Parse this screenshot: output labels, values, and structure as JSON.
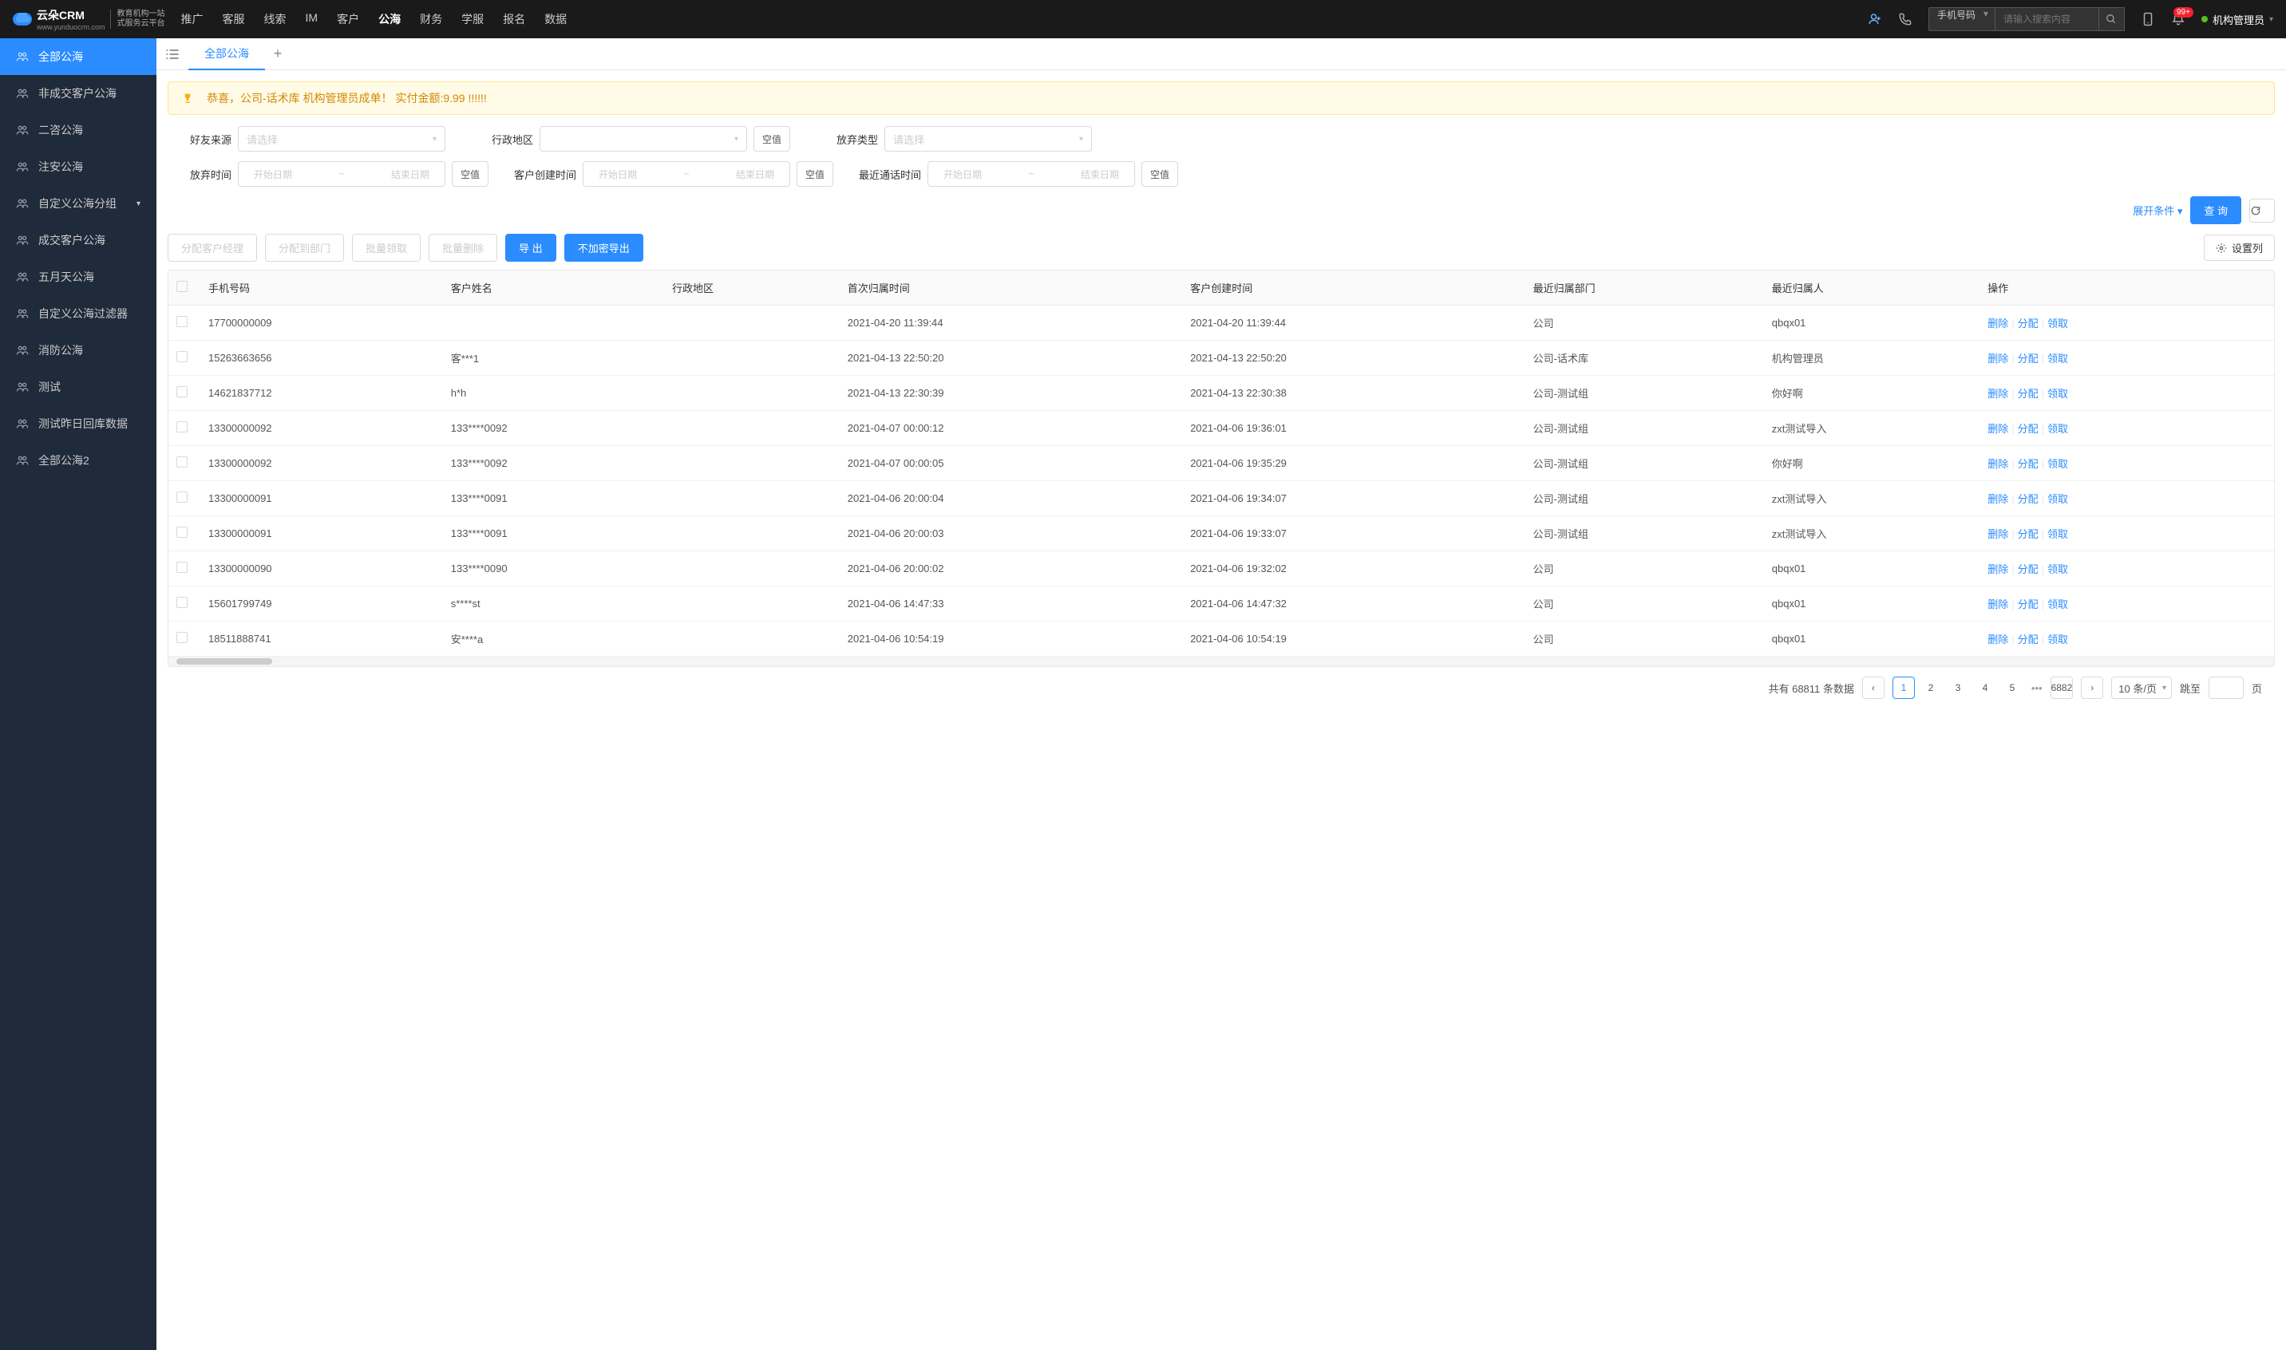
{
  "header": {
    "logo_title": "云朵CRM",
    "logo_sub1": "教育机构一站",
    "logo_sub2": "式服务云平台",
    "logo_url": "www.yunduocrm.com",
    "nav": [
      "推广",
      "客服",
      "线索",
      "IM",
      "客户",
      "公海",
      "财务",
      "学服",
      "报名",
      "数据"
    ],
    "nav_active": 5,
    "search_type": "手机号码",
    "search_placeholder": "请输入搜索内容",
    "badge": "99+",
    "user": "机构管理员"
  },
  "sidebar": [
    {
      "label": "全部公海",
      "active": true
    },
    {
      "label": "非成交客户公海"
    },
    {
      "label": "二咨公海"
    },
    {
      "label": "注安公海"
    },
    {
      "label": "自定义公海分组",
      "expandable": true
    },
    {
      "label": "成交客户公海"
    },
    {
      "label": "五月天公海"
    },
    {
      "label": "自定义公海过滤器"
    },
    {
      "label": "消防公海"
    },
    {
      "label": "测试"
    },
    {
      "label": "测试昨日回库数据"
    },
    {
      "label": "全部公海2"
    }
  ],
  "tab": {
    "label": "全部公海"
  },
  "banner": "恭喜，公司-话术库  机构管理员成单！  实付金额:9.99 !!!!!!",
  "filters": {
    "source_label": "好友来源",
    "region_label": "行政地区",
    "abandon_type_label": "放弃类型",
    "abandon_time_label": "放弃时间",
    "create_time_label": "客户创建时间",
    "call_time_label": "最近通话时间",
    "select_placeholder": "请选择",
    "start_placeholder": "开始日期",
    "end_placeholder": "结束日期",
    "null_btn": "空值",
    "expand": "展开条件",
    "query": "查 询"
  },
  "toolbar": {
    "assign_manager": "分配客户经理",
    "assign_dept": "分配到部门",
    "batch_claim": "批量领取",
    "batch_delete": "批量删除",
    "export": "导 出",
    "export_plain": "不加密导出",
    "columns": "设置列"
  },
  "table": {
    "columns": [
      "手机号码",
      "客户姓名",
      "行政地区",
      "首次归属时间",
      "客户创建时间",
      "最近归属部门",
      "最近归属人",
      "操作"
    ],
    "actions": {
      "delete": "删除",
      "assign": "分配",
      "claim": "领取"
    },
    "rows": [
      {
        "phone": "17700000009",
        "name": "",
        "region": "",
        "first_time": "2021-04-20 11:39:44",
        "create_time": "2021-04-20 11:39:44",
        "dept": "公司",
        "owner": "qbqx01"
      },
      {
        "phone": "15263663656",
        "name": "客***1",
        "region": "",
        "first_time": "2021-04-13 22:50:20",
        "create_time": "2021-04-13 22:50:20",
        "dept": "公司-话术库",
        "owner": "机构管理员"
      },
      {
        "phone": "14621837712",
        "name": "h*h",
        "region": "",
        "first_time": "2021-04-13 22:30:39",
        "create_time": "2021-04-13 22:30:38",
        "dept": "公司-测试组",
        "owner": "你好啊"
      },
      {
        "phone": "13300000092",
        "name": "133****0092",
        "region": "",
        "first_time": "2021-04-07 00:00:12",
        "create_time": "2021-04-06 19:36:01",
        "dept": "公司-测试组",
        "owner": "zxt测试导入"
      },
      {
        "phone": "13300000092",
        "name": "133****0092",
        "region": "",
        "first_time": "2021-04-07 00:00:05",
        "create_time": "2021-04-06 19:35:29",
        "dept": "公司-测试组",
        "owner": "你好啊"
      },
      {
        "phone": "13300000091",
        "name": "133****0091",
        "region": "",
        "first_time": "2021-04-06 20:00:04",
        "create_time": "2021-04-06 19:34:07",
        "dept": "公司-测试组",
        "owner": "zxt测试导入"
      },
      {
        "phone": "13300000091",
        "name": "133****0091",
        "region": "",
        "first_time": "2021-04-06 20:00:03",
        "create_time": "2021-04-06 19:33:07",
        "dept": "公司-测试组",
        "owner": "zxt测试导入"
      },
      {
        "phone": "13300000090",
        "name": "133****0090",
        "region": "",
        "first_time": "2021-04-06 20:00:02",
        "create_time": "2021-04-06 19:32:02",
        "dept": "公司",
        "owner": "qbqx01"
      },
      {
        "phone": "15601799749",
        "name": "s****st",
        "region": "",
        "first_time": "2021-04-06 14:47:33",
        "create_time": "2021-04-06 14:47:32",
        "dept": "公司",
        "owner": "qbqx01"
      },
      {
        "phone": "18511888741",
        "name": "安****a",
        "region": "",
        "first_time": "2021-04-06 10:54:19",
        "create_time": "2021-04-06 10:54:19",
        "dept": "公司",
        "owner": "qbqx01"
      }
    ]
  },
  "pagination": {
    "total_prefix": "共有",
    "total": "68811",
    "total_suffix": "条数据",
    "pages": [
      "1",
      "2",
      "3",
      "4",
      "5"
    ],
    "last_page": "6882",
    "per_page": "10 条/页",
    "jump_prefix": "跳至",
    "jump_suffix": "页"
  }
}
